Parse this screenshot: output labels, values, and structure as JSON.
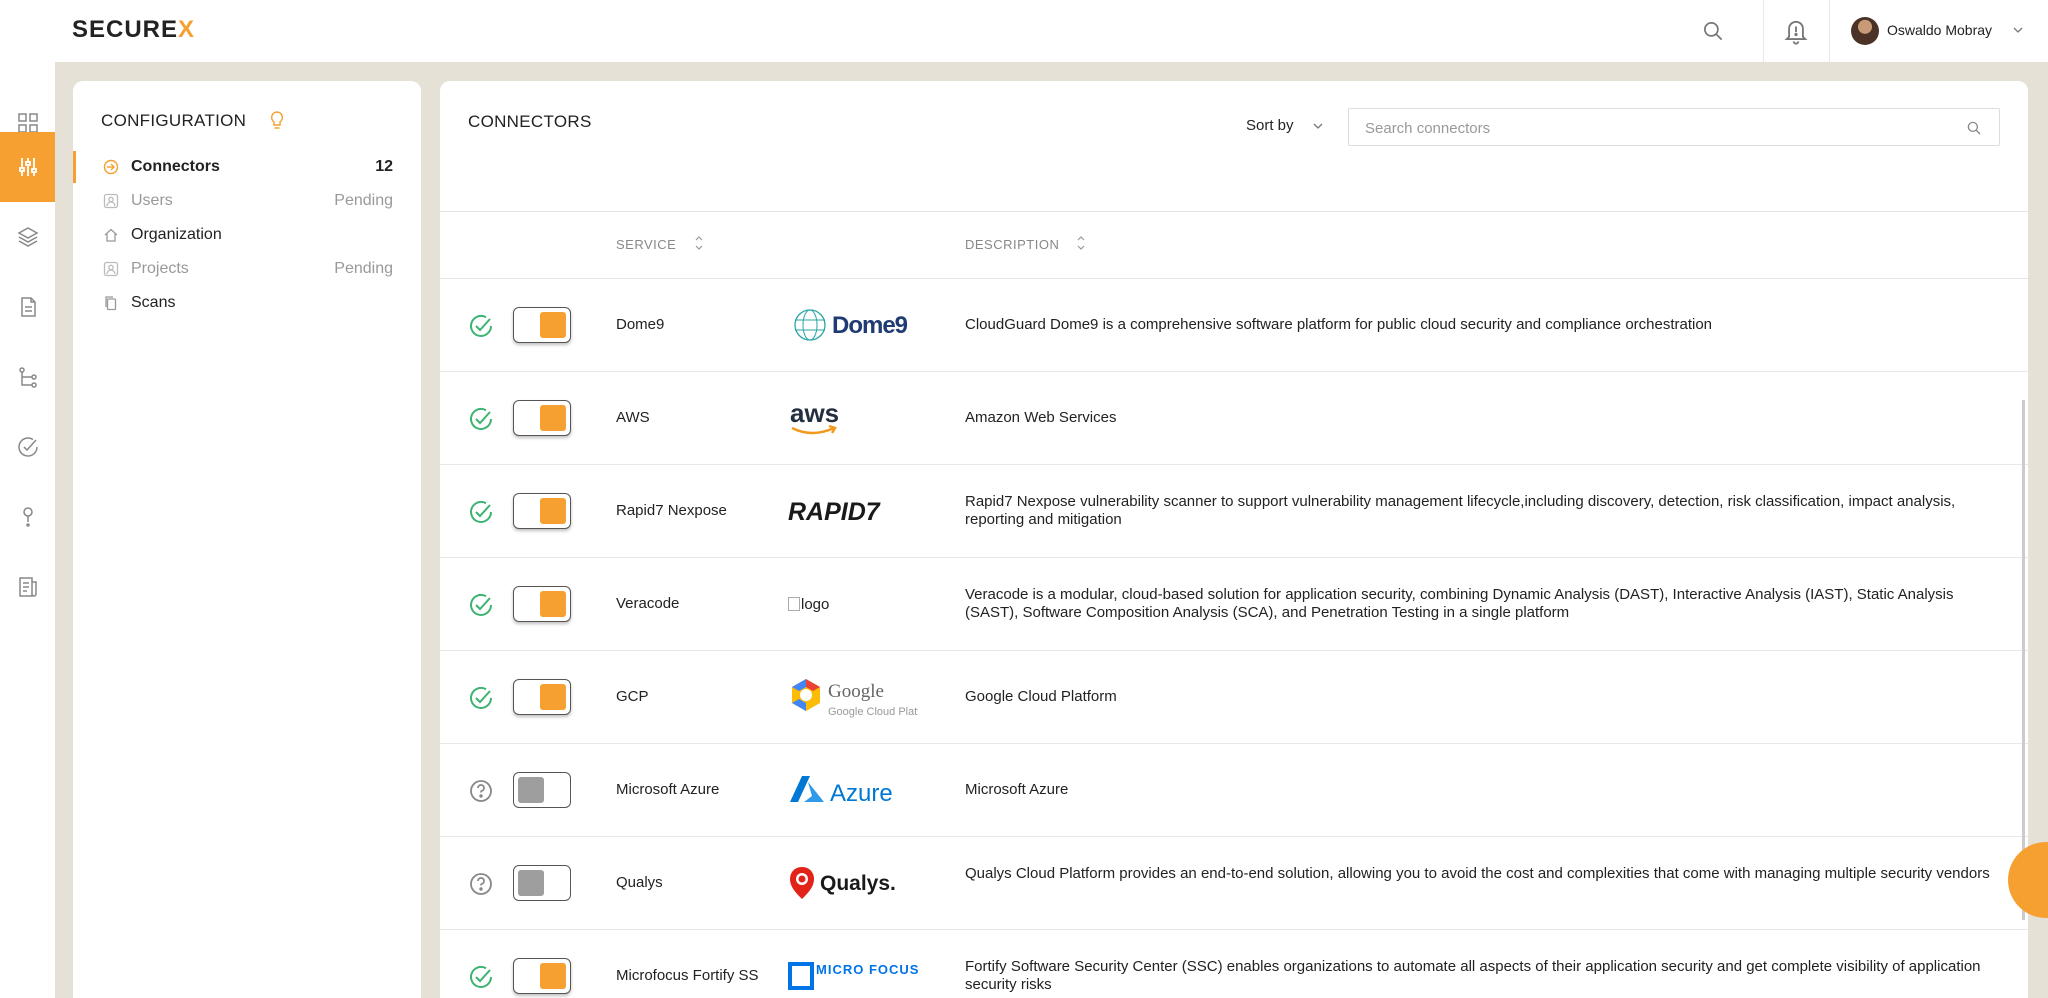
{
  "brand": {
    "name_prefix": "SECURE",
    "name_suffix": "X"
  },
  "user": {
    "name": "Oswaldo Mobray"
  },
  "config": {
    "title": "CONFIGURATION",
    "items": [
      {
        "label": "Connectors",
        "meta": "12"
      },
      {
        "label": "Users",
        "meta": "Pending"
      },
      {
        "label": "Organization",
        "meta": ""
      },
      {
        "label": "Projects",
        "meta": "Pending"
      },
      {
        "label": "Scans",
        "meta": ""
      }
    ]
  },
  "connectors": {
    "title": "CONNECTORS",
    "sort_label": "Sort by",
    "search_placeholder": "Search connectors",
    "columns": {
      "service": "SERVICE",
      "description": "DESCRIPTION"
    },
    "rows": [
      {
        "service": "Dome9",
        "logo": "Dome9",
        "enabled": true,
        "status": "check-circle-icon",
        "description": "CloudGuard Dome9 is a comprehensive software platform for public cloud security and compliance orchestration"
      },
      {
        "service": "AWS",
        "logo": "aws",
        "enabled": true,
        "status": "check-circle-icon",
        "description": "Amazon Web Services"
      },
      {
        "service": "Rapid7 Nexpose",
        "logo": "RAPID7",
        "enabled": true,
        "status": "check-circle-icon",
        "description": "Rapid7 Nexpose vulnerability scanner to support vulnerability management lifecycle,including discovery, detection, risk classification, impact analysis, reporting and mitigation"
      },
      {
        "service": "Veracode",
        "logo": "logo",
        "enabled": true,
        "status": "check-circle-icon",
        "description": "Veracode is a modular, cloud-based solution for application security, combining Dynamic Analysis (DAST), Interactive Analysis (IAST), Static Analysis (SAST), Software Composition Analysis (SCA), and Penetration Testing in a single platform"
      },
      {
        "service": "GCP",
        "logo": "Google Cloud Platform",
        "enabled": true,
        "status": "check-circle-icon",
        "description": "Google Cloud Platform"
      },
      {
        "service": "Microsoft Azure",
        "logo": "Azure",
        "enabled": false,
        "status": "question-circle-icon",
        "description": "Microsoft Azure"
      },
      {
        "service": "Qualys",
        "logo": "Qualys.",
        "enabled": false,
        "status": "question-circle-icon",
        "description": "Qualys Cloud Platform provides an end-to-end solution, allowing you to avoid the cost and complexities that come with managing multiple security vendors"
      },
      {
        "service": "Microfocus Fortify SS",
        "logo": "MICRO FOCUS",
        "enabled": true,
        "status": "check-circle-icon",
        "description": "Fortify Software Security Center (SSC) enables organizations to automate all aspects of their application security and get complete visibility of application security risks"
      }
    ]
  },
  "colors": {
    "accent": "#f5a030",
    "success": "#3cb371",
    "muted": "#999999"
  }
}
